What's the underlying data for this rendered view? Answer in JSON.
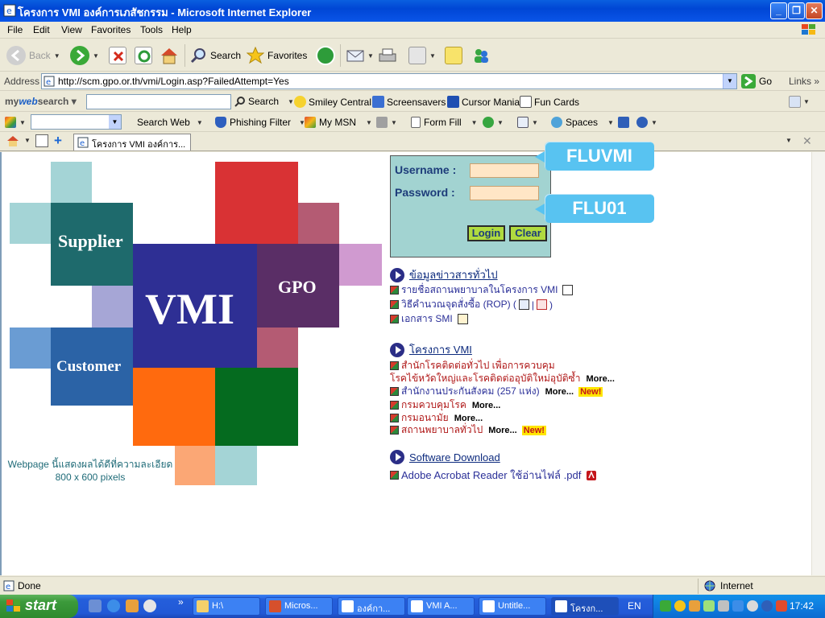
{
  "window": {
    "title": "โครงการ VMI องค์การเภสัชกรรม - Microsoft Internet Explorer"
  },
  "menu": [
    "File",
    "Edit",
    "View",
    "Favorites",
    "Tools",
    "Help"
  ],
  "toolbar": {
    "back": "Back",
    "search": "Search",
    "favorites": "Favorites"
  },
  "address": {
    "label": "Address",
    "url": "http://scm.gpo.or.th/vmi/Login.asp?FailedAttempt=Yes",
    "go": "Go",
    "links": "Links"
  },
  "mywebsearch": {
    "brand_prefix": "my",
    "brand_main": "web",
    "brand_suffix": "search",
    "search_button": "Search",
    "items": [
      "Smiley Central",
      "Screensavers",
      "Cursor Mania",
      "Fun Cards"
    ]
  },
  "msn": {
    "search_web": "Search Web",
    "phishing_filter": "Phishing Filter",
    "my_msn": "My MSN",
    "form_fill": "Form Fill",
    "spaces": "Spaces"
  },
  "tab": {
    "label": "โครงการ VMI องค์การ..."
  },
  "logo": {
    "supplier": "Supplier",
    "vmi": "VMI",
    "gpo": "GPO",
    "customer": "Customer"
  },
  "resolution_note": {
    "line1": "Webpage นี้แสดงผลได้ดีที่ความละเอียด",
    "line2": "800 x 600 pixels"
  },
  "login": {
    "username_label": "Username :",
    "password_label": "Password :",
    "login_button": "Login",
    "clear_button": "Clear"
  },
  "callouts": {
    "username": "FLUVMI",
    "password": "FLU01"
  },
  "news": {
    "heading": "ข้อมูลข่าวสารทั่วไป",
    "items": [
      "รายชื่อสถานพยาบาลในโครงการ VMI",
      "วิธีคำนวณจุดสั่งซื้อ (ROP) (",
      "เอกสาร SMI"
    ],
    "rop_separator": "|",
    "rop_close": ")"
  },
  "project": {
    "heading": "โครงการ VMI",
    "items": [
      {
        "text": "สำนักโรคติดต่อทั่วไป เพื่อการควบคุม",
        "color": "red"
      },
      {
        "text": "โรคไข้หวัดใหญ่และโรคติดต่ออุบัติใหม่อุบัติซ้ำ",
        "color": "red",
        "more": "More..."
      },
      {
        "text": "สำนักงานประกันสังคม (257 แห่ง)",
        "color": "blue",
        "more": "More...",
        "badge": "New!"
      },
      {
        "text": "กรมควบคุมโรค",
        "color": "red",
        "more": "More..."
      },
      {
        "text": "กรมอนามัย",
        "color": "red",
        "more": "More..."
      },
      {
        "text": "สถานพยาบาลทั่วไป",
        "color": "red",
        "more": "More...",
        "badge": "New!"
      }
    ]
  },
  "software": {
    "heading": "Software Download",
    "item": "Adobe Acrobat Reader ใช้อ่านไฟล์ .pdf"
  },
  "status": {
    "text": "Done",
    "zone": "Internet"
  },
  "taskbar": {
    "start": "start",
    "tasks": [
      "H:\\",
      "Micros...",
      "องค์กา...",
      "VMI A...",
      "Untitle...",
      "โครงก..."
    ],
    "lang": "EN",
    "clock": "17:42"
  },
  "colors": {
    "title_bar": "#0A5FE0",
    "login_panel": "#A2D3D1",
    "callout": "#58C3F1",
    "logo_vmi": "#2E2F94",
    "logo_supplier": "#1E6A6C",
    "logo_gpo": "#5A2E66",
    "logo_customer": "#2B63A6"
  }
}
